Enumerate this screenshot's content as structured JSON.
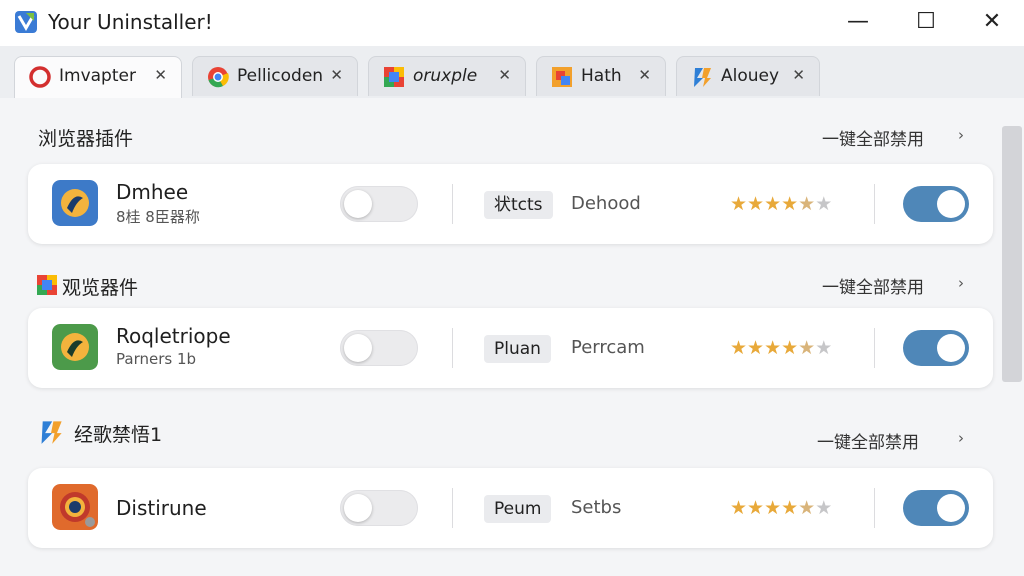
{
  "window": {
    "title": "Your Uninstaller!",
    "controls": {
      "minimize": "—",
      "maximize": "☐",
      "close": "✕"
    }
  },
  "tabs": [
    {
      "label": "Imvapter",
      "icon": "opera-icon",
      "active": true
    },
    {
      "label": "Pellicoden",
      "icon": "chrome-icon"
    },
    {
      "label": "oruxple",
      "icon": "chrome-icon"
    },
    {
      "label": "Hath",
      "icon": "puzzle-icon"
    },
    {
      "label": "Alouey",
      "icon": "edge-icon"
    }
  ],
  "tab_close": "✕",
  "sections": [
    {
      "title": "浏览器插件",
      "action": "一键全部禁用",
      "item": {
        "name": "Dmhee",
        "subtitle": "8桂 8臣器称",
        "badge": "状tcts",
        "status": "Dehood",
        "rating_text": "★★★★★",
        "enabled": true
      }
    },
    {
      "title": "观览器件",
      "action": "一键全部禁用",
      "item": {
        "name": "Roqletriope",
        "subtitle": "Parners 1b",
        "badge": "Pluan",
        "status": "Perrcam",
        "rating_text": "★★★★★",
        "enabled": true
      }
    },
    {
      "title": "经歌禁悟1",
      "action": "一键全部禁用",
      "item": {
        "name": "Distirune",
        "subtitle": "",
        "badge": "Peum",
        "status": "Setbs",
        "rating_text": "★★★★★",
        "enabled": true
      }
    }
  ],
  "chevron": "›",
  "colors": {
    "accent": "#4f87b8",
    "star": "#e8a93a"
  }
}
